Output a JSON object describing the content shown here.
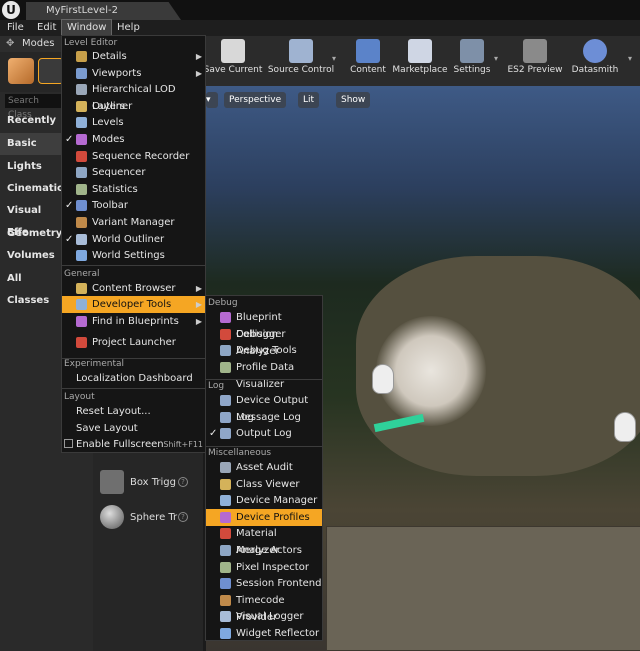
{
  "tab": {
    "title": "MyFirstLevel-2"
  },
  "menubar": [
    "File",
    "Edit",
    "Window",
    "Help"
  ],
  "modes": {
    "tab_label": "Modes",
    "search_placeholder": "Search Class"
  },
  "categories": [
    "Recently Pla",
    "Basic",
    "Lights",
    "Cinematic",
    "Visual Effe",
    "Geometry",
    "Volumes",
    "All Classes"
  ],
  "place_items": [
    "Box Trigg",
    "Sphere Tr"
  ],
  "toolbar": [
    "Save Current",
    "Source Control",
    "Content",
    "Marketplace",
    "Settings",
    "ES2 Preview",
    "Datasmith"
  ],
  "viewport": {
    "perspective": "Perspective",
    "lit": "Lit",
    "show": "Show"
  },
  "window_menu": {
    "level_editor_header": "Level Editor",
    "level_editor": [
      {
        "label": "Details",
        "check": false,
        "arrow": true
      },
      {
        "label": "Viewports",
        "check": false,
        "arrow": true
      },
      {
        "label": "Hierarchical LOD Outliner",
        "check": false,
        "arrow": false
      },
      {
        "label": "Layers",
        "check": false,
        "arrow": false
      },
      {
        "label": "Levels",
        "check": false,
        "arrow": false
      },
      {
        "label": "Modes",
        "check": true,
        "arrow": false
      },
      {
        "label": "Sequence Recorder",
        "check": false,
        "arrow": false
      },
      {
        "label": "Sequencer",
        "check": false,
        "arrow": false
      },
      {
        "label": "Statistics",
        "check": false,
        "arrow": false
      },
      {
        "label": "Toolbar",
        "check": true,
        "arrow": false
      },
      {
        "label": "Variant Manager",
        "check": false,
        "arrow": false
      },
      {
        "label": "World Outliner",
        "check": true,
        "arrow": false
      },
      {
        "label": "World Settings",
        "check": false,
        "arrow": false
      }
    ],
    "general_header": "General",
    "general": [
      {
        "label": "Content Browser",
        "arrow": true
      },
      {
        "label": "Developer Tools",
        "arrow": true
      },
      {
        "label": "Find in Blueprints",
        "arrow": true
      },
      {
        "label": "Project Launcher",
        "arrow": false
      }
    ],
    "experimental_header": "Experimental",
    "experimental": [
      "Localization Dashboard"
    ],
    "layout_header": "Layout",
    "layout": [
      "Reset Layout...",
      "Save Layout"
    ],
    "fullscreen": {
      "label": "Enable Fullscreen",
      "shortcut": "Shift+F11"
    }
  },
  "dev_tools_menu": {
    "debug_header": "Debug",
    "debug": [
      "Blueprint Debugger",
      "Collision Analyzer",
      "Debug Tools",
      "Profile Data Visualizer"
    ],
    "log_header": "Log",
    "log": [
      {
        "label": "Device Output Log",
        "check": false
      },
      {
        "label": "Message Log",
        "check": false
      },
      {
        "label": "Output Log",
        "check": true
      }
    ],
    "misc_header": "Miscellaneous",
    "misc": [
      "Asset Audit",
      "Class Viewer",
      "Device Manager",
      "Device Profiles",
      "Material Analyzer",
      "Merge Actors",
      "Pixel Inspector",
      "Session Frontend",
      "Timecode Provider",
      "Visual Logger",
      "Widget Reflector"
    ],
    "highlighted": "Device Profiles"
  },
  "colors": {
    "highlight": "#f5a623",
    "menu_bg": "#151515"
  }
}
